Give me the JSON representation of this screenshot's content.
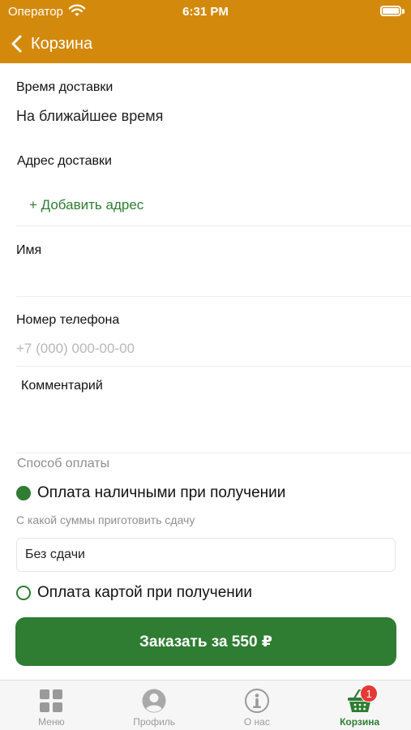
{
  "status_bar": {
    "carrier": "Оператор",
    "time": "6:31 PM"
  },
  "nav": {
    "title": "Корзина",
    "back_icon": "chevron-left-icon"
  },
  "form": {
    "delivery_time": {
      "label": "Время доставки",
      "value": "На ближайшее время"
    },
    "delivery_address": {
      "label": "Адрес доставки",
      "add_label": "+ Добавить адрес"
    },
    "name": {
      "label": "Имя",
      "value": "",
      "placeholder": ""
    },
    "phone": {
      "label": "Номер телефона",
      "value": "",
      "placeholder": "+7 (000) 000-00-00"
    },
    "comment": {
      "label": "Комментарий",
      "value": ""
    }
  },
  "payment": {
    "title": "Способ оплаты",
    "options": [
      {
        "label": "Оплата наличными при получении",
        "selected": true
      },
      {
        "label": "Оплата картой при получении",
        "selected": false
      }
    ],
    "change_hint": "С какой суммы приготовить сдачу",
    "change_value": "Без сдачи"
  },
  "order_button": {
    "label": "Заказать за 550 ₽"
  },
  "tabbar": {
    "items": [
      {
        "label": "Меню",
        "icon": "grid-icon",
        "active": false
      },
      {
        "label": "Профиль",
        "icon": "profile-icon",
        "active": false
      },
      {
        "label": "О нас",
        "icon": "info-icon",
        "active": false
      },
      {
        "label": "Корзина",
        "icon": "basket-icon",
        "active": true,
        "badge": "1"
      }
    ]
  },
  "colors": {
    "header": "#d38a0c",
    "accent": "#2e7d32",
    "badge": "#e53935"
  }
}
